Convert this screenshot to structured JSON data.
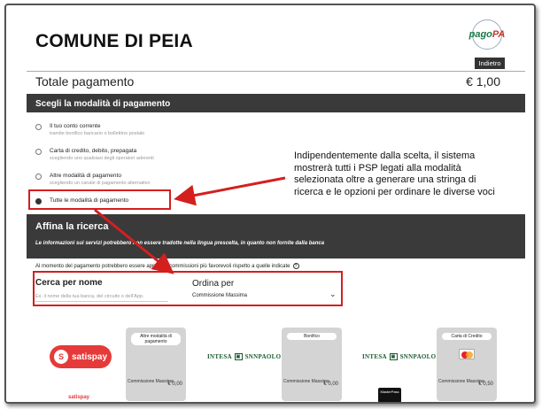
{
  "header": {
    "title": "COMUNE DI PEIA",
    "logo_text_a": "pago",
    "logo_text_b": "PA",
    "back_label": "Indietro"
  },
  "total": {
    "label": "Totale pagamento",
    "amount": "€ 1,00"
  },
  "methods": {
    "heading": "Scegli la modalità di pagamento",
    "options": [
      {
        "label": "Il tuo conto corrente",
        "sub": "tramite bonifico bancario o bollettino postale",
        "selected": false
      },
      {
        "label": "Carta di credito, debito, prepagata",
        "sub": "scegliendo uno qualsiasi degli operatori aderenti",
        "selected": false
      },
      {
        "label": "Altre modalità di pagamento",
        "sub": "scegliendo un canale di pagamento alternativo",
        "selected": false
      },
      {
        "label": "Tutte le modalità di pagamento",
        "sub": "",
        "selected": true
      }
    ]
  },
  "refine": {
    "heading": "Affina la ricerca",
    "note": "Le informazioni sui servizi potrebbero non essere tradotte nella lingua prescelta, in quanto non fornite dalla banca",
    "notice": "Al momento del pagamento potrebbero essere applicate commissioni più favorevoli rispetto a quelle indicate",
    "search_label": "Cerca per nome",
    "search_placeholder": "Es. il nome della tua banca, del circuito o dell'App.",
    "sort_label": "Ordina per",
    "sort_value": "Commissione Massima"
  },
  "callout": "Indipendentemente dalla scelta, il sistema mostrerà tutti i PSP legati alla modalità selezionata oltre a  generare una stringa di ricerca e le opzioni per ordinare le diverse voci",
  "providers": [
    {
      "logo": "satispay",
      "small_logo": "satispay",
      "card_title": "Altre modalità di pagamento",
      "commission": "Commissione Massima",
      "fee": "€ 0,00"
    },
    {
      "logo": "INTESA SANPAOLO",
      "card_title": "Bonifico",
      "commission": "Commissione Massima",
      "fee": "€ 0,00"
    },
    {
      "logo": "INTESA SANPAOLO",
      "small_logo": "MasterPass",
      "card_title": "Carta di Credito",
      "commission": "Commissione Massima",
      "fee": "€ 0,50"
    }
  ],
  "colors": {
    "accent_red": "#d41f1f",
    "bar_bg": "#3a3a3a"
  }
}
